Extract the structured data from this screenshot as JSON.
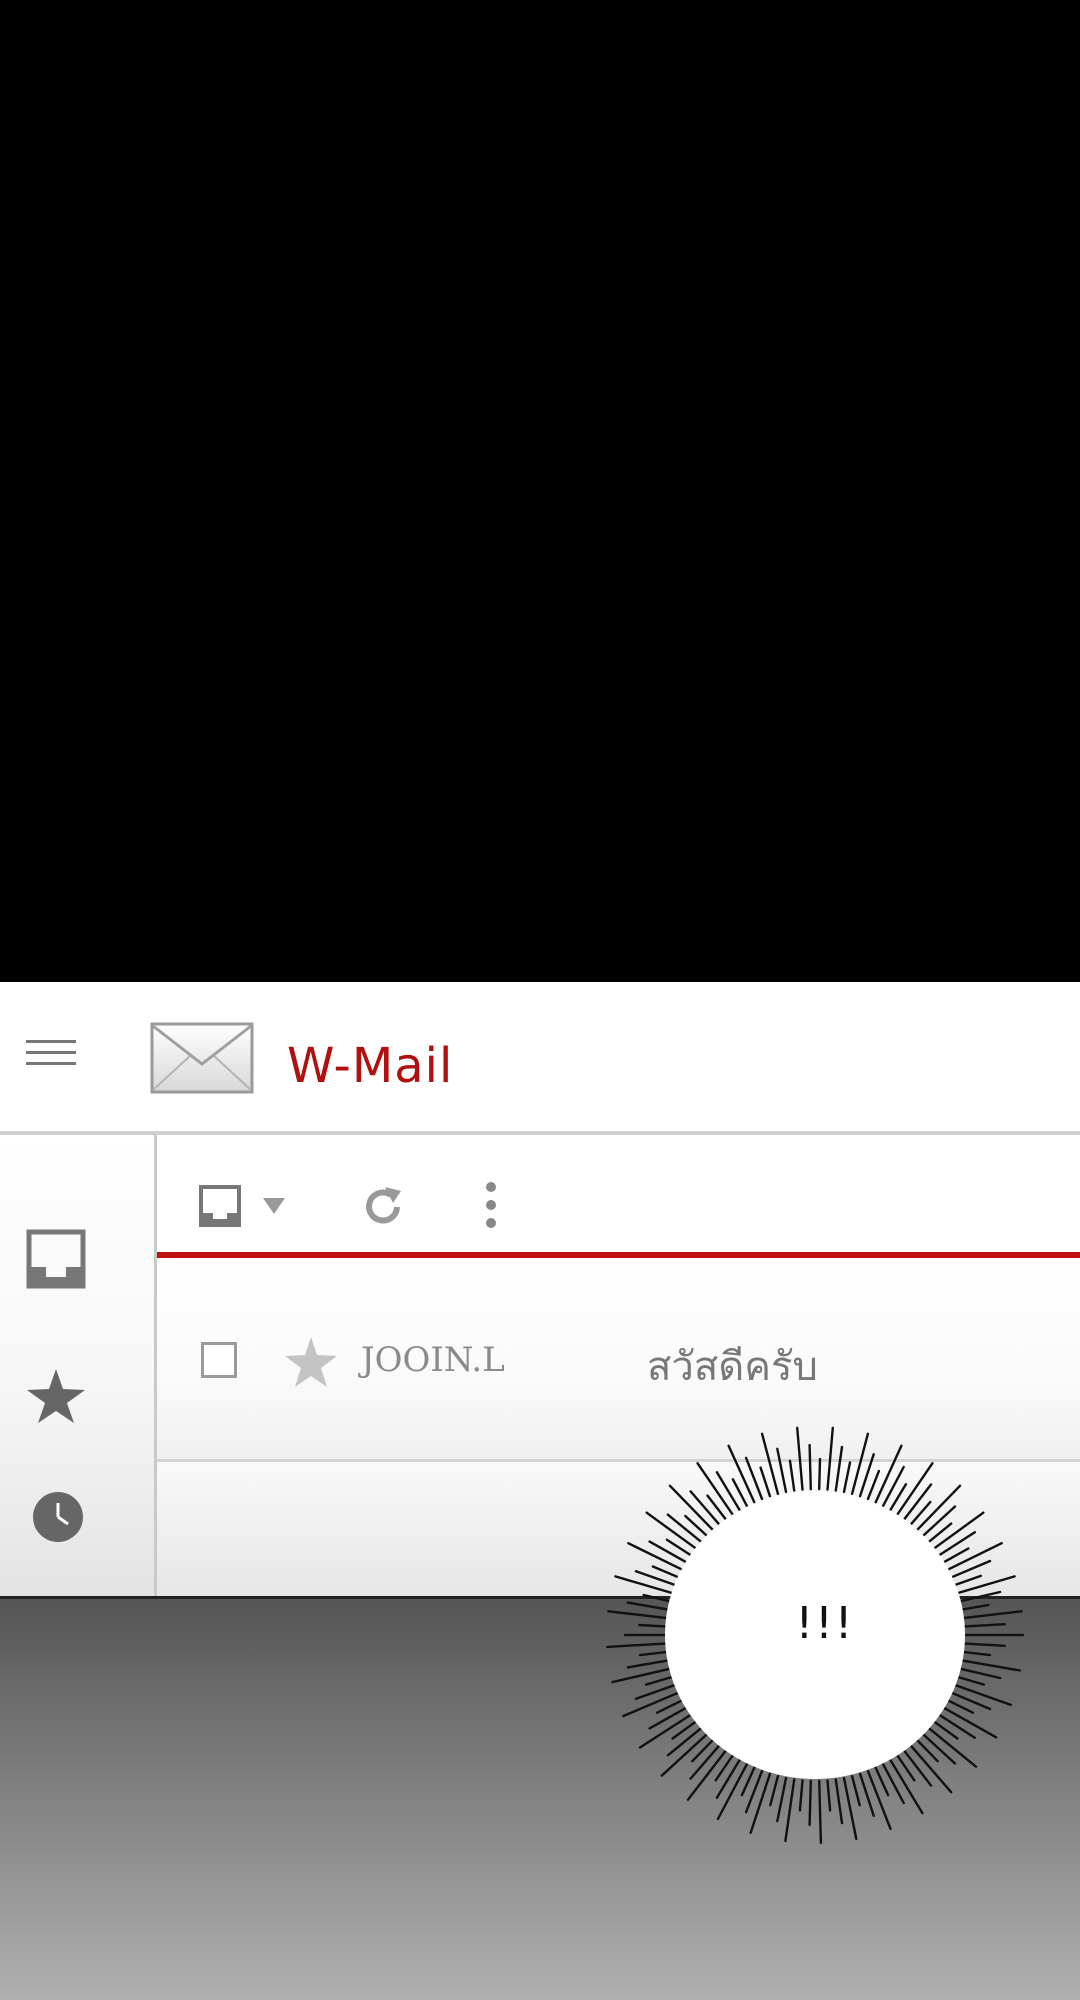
{
  "app": {
    "title": "W-Mail"
  },
  "toolbar": {
    "icons": [
      "inbox-select-icon",
      "dropdown-arrow-icon",
      "refresh-icon",
      "more-vert-icon"
    ]
  },
  "sidebar": {
    "items": [
      {
        "icon": "inbox-icon"
      },
      {
        "icon": "star-icon"
      },
      {
        "icon": "clock-icon"
      }
    ]
  },
  "mail_list": {
    "rows": [
      {
        "sender": "JOOIN.L",
        "subject": "สวัสดีครับ",
        "starred": false
      }
    ]
  },
  "overlay": {
    "exclamation": "!!!"
  },
  "colors": {
    "accent": "#c01010",
    "title": "#b01010",
    "icon_gray": "#777777"
  }
}
